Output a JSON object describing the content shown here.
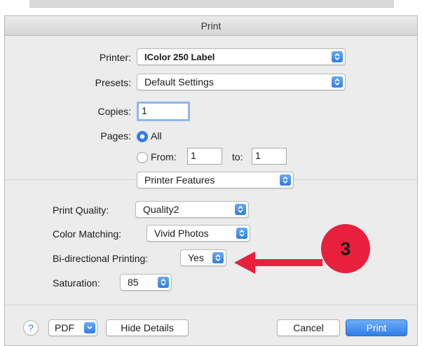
{
  "dialog": {
    "title": "Print"
  },
  "printer": {
    "label": "Printer:",
    "value": "IColor 250 Label"
  },
  "presets": {
    "label": "Presets:",
    "value": "Default Settings"
  },
  "copies": {
    "label": "Copies:",
    "value": "1"
  },
  "pages": {
    "label": "Pages:",
    "all_label": "All",
    "from_label": "From:",
    "from_value": "1",
    "to_label": "to:",
    "to_value": "1",
    "selected": "All"
  },
  "section_menu": {
    "value": "Printer Features"
  },
  "features": {
    "print_quality": {
      "label": "Print Quality:",
      "value": "Quality2"
    },
    "color_matching": {
      "label": "Color Matching:",
      "value": "Vivid Photos"
    },
    "bidirectional": {
      "label": "Bi-directional Printing:",
      "value": "Yes"
    },
    "saturation": {
      "label": "Saturation:",
      "value": "85"
    }
  },
  "annotation": {
    "step_number": "3",
    "color": "#e8203c"
  },
  "footer": {
    "help_label": "?",
    "pdf_label": "PDF",
    "hide_details_label": "Hide Details",
    "cancel_label": "Cancel",
    "print_label": "Print"
  },
  "colors": {
    "accent": "#2f7de6",
    "dialog_bg": "#ececec"
  }
}
